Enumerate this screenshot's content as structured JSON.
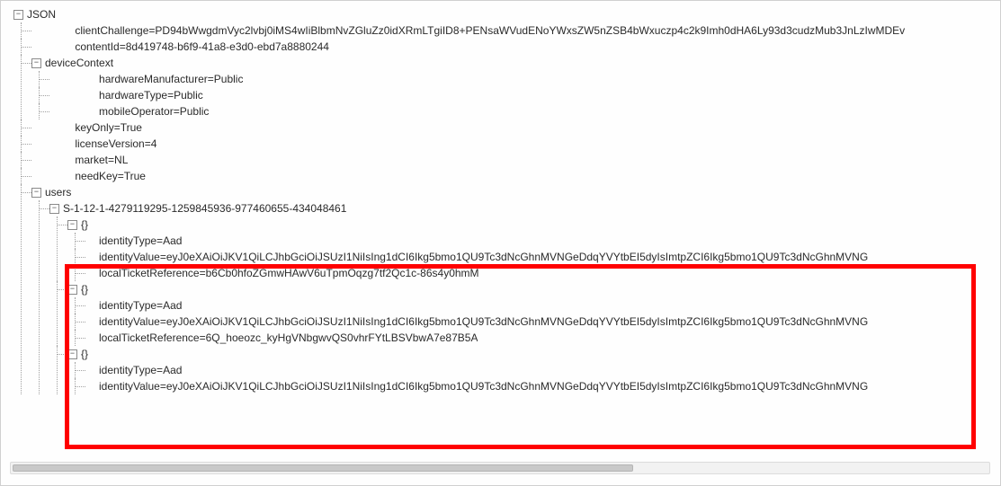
{
  "root": {
    "label": "JSON",
    "expanded": true,
    "children": [
      {
        "kv": true,
        "key": "clientChallenge",
        "value": "PD94bWwgdmVyc2lvbj0iMS4wIiBlbmNvZGluZz0idXRmLTgiID8+PENsaWVudENoYWxsZW5nZSB4bWxuczp4c2k9Imh0dHA6Ly93d3cudzMub3JnLzIwMDEv"
      },
      {
        "kv": true,
        "key": "contentId",
        "value": "8d419748-b6f9-41a8-e3d0-ebd7a8880244"
      },
      {
        "label": "deviceContext",
        "expanded": true,
        "children": [
          {
            "kv": true,
            "key": "hardwareManufacturer",
            "value": "Public"
          },
          {
            "kv": true,
            "key": "hardwareType",
            "value": "Public"
          },
          {
            "kv": true,
            "key": "mobileOperator",
            "value": "Public"
          }
        ]
      },
      {
        "kv": true,
        "key": "keyOnly",
        "value": "True"
      },
      {
        "kv": true,
        "key": "licenseVersion",
        "value": "4"
      },
      {
        "kv": true,
        "key": "market",
        "value": "NL"
      },
      {
        "kv": true,
        "key": "needKey",
        "value": "True"
      },
      {
        "label": "users",
        "expanded": true,
        "children": [
          {
            "label": "S-1-12-1-4279119295-1259845936-977460655-434048461",
            "expanded": true,
            "children": [
              {
                "label": "{}",
                "expanded": true,
                "children": [
                  {
                    "kv": true,
                    "key": "identityType",
                    "value": "Aad"
                  },
                  {
                    "kv": true,
                    "key": "identityValue",
                    "value": "eyJ0eXAiOiJKV1QiLCJhbGciOiJSUzI1NiIsIng1dCI6Ikg5bmo1QU9Tc3dNcGhnMVNGeDdqYVYtbEI5dyIsImtpZCI6Ikg5bmo1QU9Tc3dNcGhnMVNG"
                  },
                  {
                    "kv": true,
                    "key": "localTicketReference",
                    "value": "b6Cb0hfoZGmwHAwV6uTpmOqzg7tf2Qc1c-86s4y0hmM"
                  }
                ]
              },
              {
                "label": "{}",
                "expanded": true,
                "children": [
                  {
                    "kv": true,
                    "key": "identityType",
                    "value": "Aad"
                  },
                  {
                    "kv": true,
                    "key": "identityValue",
                    "value": "eyJ0eXAiOiJKV1QiLCJhbGciOiJSUzI1NiIsIng1dCI6Ikg5bmo1QU9Tc3dNcGhnMVNGeDdqYVYtbEI5dyIsImtpZCI6Ikg5bmo1QU9Tc3dNcGhnMVNG"
                  },
                  {
                    "kv": true,
                    "key": "localTicketReference",
                    "value": "6Q_hoeozc_kyHgVNbgwvQS0vhrFYtLBSVbwA7e87B5A"
                  }
                ]
              },
              {
                "label": "{}",
                "expanded": true,
                "children": [
                  {
                    "kv": true,
                    "key": "identityType",
                    "value": "Aad"
                  },
                  {
                    "kv": true,
                    "key": "identityValue",
                    "value": "eyJ0eXAiOiJKV1QiLCJhbGciOiJSUzI1NiIsIng1dCI6Ikg5bmo1QU9Tc3dNcGhnMVNGeDdqYVYtbEI5dyIsImtpZCI6Ikg5bmo1QU9Tc3dNcGhnMVNG"
                  }
                ]
              }
            ]
          }
        ]
      }
    ]
  },
  "glyph": {
    "expanded": "−",
    "collapsed": "+"
  }
}
